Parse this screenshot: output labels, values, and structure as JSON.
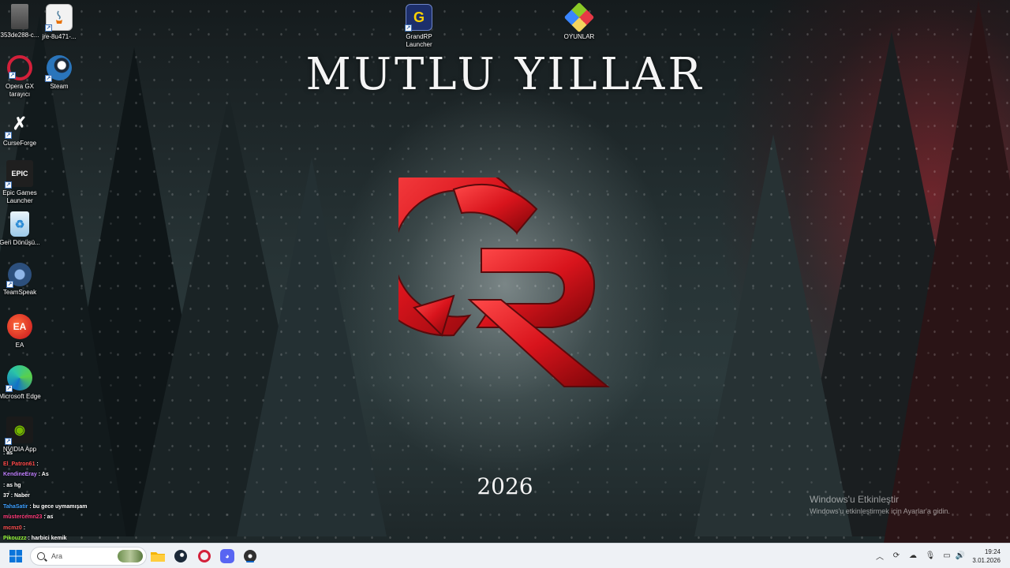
{
  "wallpaper": {
    "title": "MUTLU YILLAR",
    "year": "2026"
  },
  "desktop_icons": [
    {
      "label": "353de288-c...",
      "icon": "file-icon",
      "color": "#8b8b8b"
    },
    {
      "label": "jre-8u471-...",
      "icon": "java-icon",
      "color": "#e8e8e8"
    },
    {
      "label": "GrandRP Launcher",
      "icon": "grandrp-icon",
      "color": "#1f3a8a"
    },
    {
      "label": "OYUNLAR",
      "icon": "folder-icon",
      "color": "#c0392b"
    },
    {
      "label": "Opera GX tarayıcı",
      "icon": "opera-gx-icon",
      "color": "#d3203a"
    },
    {
      "label": "Steam",
      "icon": "steam-icon",
      "color": "#1b2838"
    },
    {
      "label": "CurseForge",
      "icon": "curseforge-icon",
      "color": "#f0f0f0"
    },
    {
      "label": "Epic Games Launcher",
      "icon": "epic-games-icon",
      "color": "#2a2a2a"
    },
    {
      "label": "Geri Dönüşü...",
      "icon": "recycle-bin-icon",
      "color": "#3a9ad9"
    },
    {
      "label": "TeamSpeak",
      "icon": "teamspeak-icon",
      "color": "#2c4f7c"
    },
    {
      "label": "EA",
      "icon": "ea-icon",
      "color": "#e2231a"
    },
    {
      "label": "Microsoft Edge",
      "icon": "edge-icon",
      "color": "#1aa0b4"
    },
    {
      "label": "NVIDIA App",
      "icon": "nvidia-icon",
      "color": "#76b900"
    }
  ],
  "chat": [
    {
      "user": "",
      "text": ": as",
      "color": "#ffffff"
    },
    {
      "user": "El_Patron61",
      "text": ":",
      "color": "#ff4a4a"
    },
    {
      "user": "KendineEray",
      "text": ": As",
      "color": "#c080ff"
    },
    {
      "user": "",
      "text": ": as hg",
      "color": "#ffffff"
    },
    {
      "user": "",
      "text": "37 : Naber",
      "color": "#7ab0ff"
    },
    {
      "user": "TahaSatir",
      "text": ": bu gece uymamışam",
      "color": "#3da0ff"
    },
    {
      "user": "mustercemn23",
      "text": ": as",
      "color": "#ff3b7a"
    },
    {
      "user": "mcmz0",
      "text": ":",
      "color": "#ff5050"
    },
    {
      "user": "Pikouzzz",
      "text": ": harbici kemik",
      "color": "#9bff3d"
    }
  ],
  "activation": {
    "line1": "Windows'u Etkinleştir",
    "line2": "Windows'u etkinleştirmek için Ayarlar'a gidin."
  },
  "taskbar": {
    "search_placeholder": "Ara",
    "apps": [
      "file-explorer-icon",
      "steam-icon",
      "opera-gx-icon",
      "discord-icon",
      "obs-icon"
    ]
  },
  "clock": {
    "time": "19:24",
    "date": "3.01.2026"
  }
}
